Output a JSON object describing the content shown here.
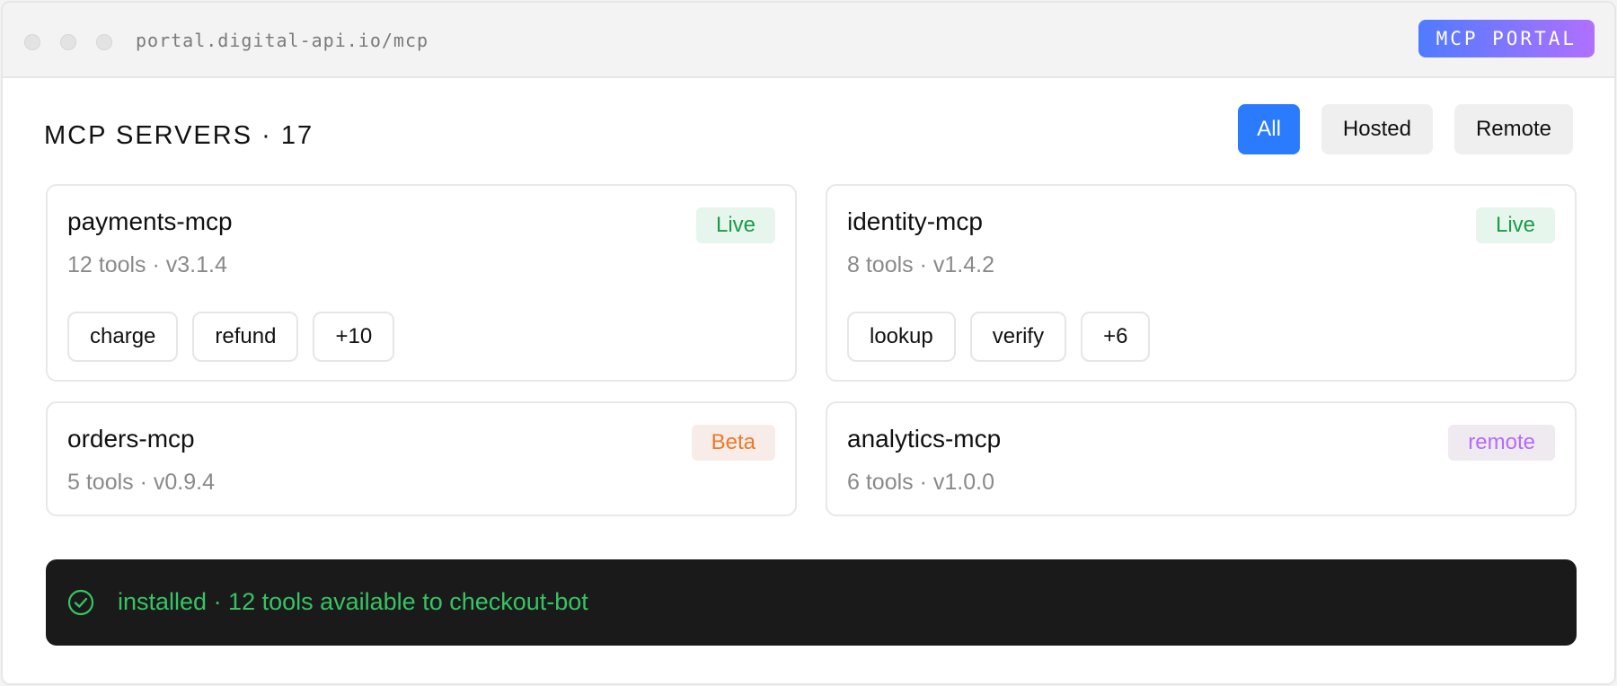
{
  "browser": {
    "url": "portal.digital-api.io/mcp",
    "badge": "MCP PORTAL"
  },
  "header": {
    "title": "MCP SERVERS · 17",
    "filters": [
      {
        "label": "All",
        "active": true
      },
      {
        "label": "Hosted",
        "active": false
      },
      {
        "label": "Remote",
        "active": false
      }
    ]
  },
  "servers": [
    {
      "name": "payments-mcp",
      "meta": "12 tools · v3.1.4",
      "status": "Live",
      "tags": [
        "charge",
        "refund",
        "+10"
      ]
    },
    {
      "name": "identity-mcp",
      "meta": "8 tools · v1.4.2",
      "status": "Live",
      "tags": [
        "lookup",
        "verify",
        "+6"
      ]
    },
    {
      "name": "orders-mcp",
      "meta": "5 tools · v0.9.4",
      "status": "Beta"
    },
    {
      "name": "analytics-mcp",
      "meta": "6 tools · v1.0.0",
      "status": "remote"
    }
  ],
  "toast": {
    "icon": "check-circle-icon",
    "message": "installed · 12 tools available to checkout-bot"
  },
  "colors": {
    "accent": "#2b7bff",
    "live": "#1f9a4c",
    "beta": "#ea7a2c",
    "remote": "#b46bff",
    "success": "#36c464"
  }
}
